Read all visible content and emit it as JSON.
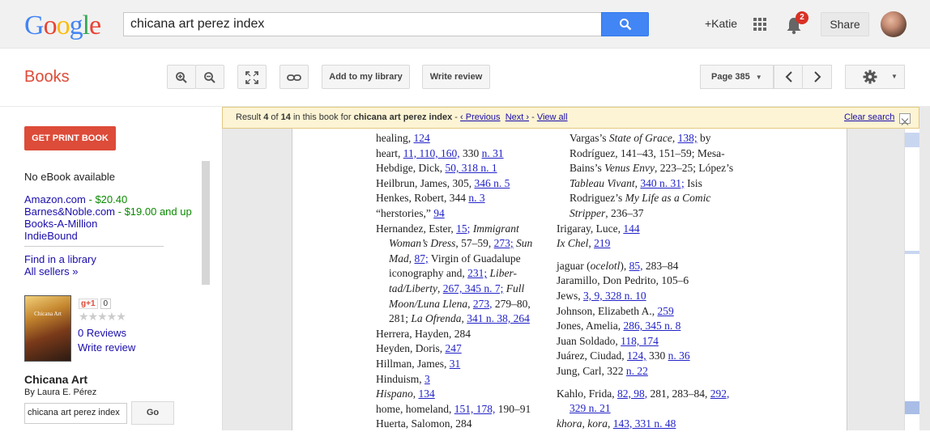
{
  "topbar": {
    "logo_letters": [
      {
        "c": "G",
        "color": "#4285f4"
      },
      {
        "c": "o",
        "color": "#ea4335"
      },
      {
        "c": "o",
        "color": "#fbbc05"
      },
      {
        "c": "g",
        "color": "#4285f4"
      },
      {
        "c": "l",
        "color": "#34a853"
      },
      {
        "c": "e",
        "color": "#ea4335"
      }
    ],
    "search_value": "chicana art perez index",
    "user": "+Katie",
    "notif_count": "2",
    "share": "Share"
  },
  "toolbar": {
    "app_name": "Books",
    "add_library": "Add to my library",
    "write_review": "Write review",
    "page_select": "Page 385"
  },
  "sidebar": {
    "print_button": "GET PRINT BOOK",
    "no_ebook": "No eBook available",
    "sellers": [
      {
        "name": "Amazon.com",
        "price": "- $20.40"
      },
      {
        "name": "Barnes&Noble.com",
        "price": "- $19.00 and up"
      },
      {
        "name": "Books-A-Million",
        "price": ""
      },
      {
        "name": "IndieBound",
        "price": ""
      }
    ],
    "find_library": "Find in a library",
    "all_sellers": "All sellers »",
    "cover_text": "Chicana Art",
    "gplus": "g+1",
    "gplus_count": "0",
    "stars": "★★★★★",
    "reviews_count": "0 Reviews",
    "write_review": "Write review",
    "title": "Chicana Art",
    "author": "By Laura E. Pérez",
    "search_value": "chicana art perez index",
    "go": "Go"
  },
  "result": {
    "p1": "Result ",
    "current": "4",
    "p2": " of ",
    "total": "14",
    "p3": " in this book for ",
    "query": "chicana art perez index",
    "sep1": " - ",
    "previous": "‹ Previous",
    "next": "Next ›",
    "sep2": " - ",
    "view_all": "View all",
    "clear": "Clear search"
  },
  "index_col1": [
    [
      {
        "t": "healing, "
      },
      {
        "t": "124",
        "l": 1
      }
    ],
    [
      {
        "t": "heart, "
      },
      {
        "t": "11, 110, 160,",
        "l": 1
      },
      {
        "t": " 330 "
      },
      {
        "t": "n. 31",
        "l": 1
      }
    ],
    [
      {
        "t": "Hebdige, Dick, "
      },
      {
        "t": "50, 318 n. 1",
        "l": 1
      }
    ],
    [
      {
        "t": "Heilbrun, James, 305, "
      },
      {
        "t": "346 n. 5",
        "l": 1
      }
    ],
    [
      {
        "t": "Henkes, Robert, 344 "
      },
      {
        "t": "n. 3",
        "l": 1
      }
    ],
    [
      {
        "t": "“herstories,” "
      },
      {
        "t": "94",
        "l": 1
      }
    ],
    [
      {
        "t": "Hernandez, Ester, "
      },
      {
        "t": "15;",
        "l": 1
      },
      {
        "t": " Immigrant",
        "i": 1
      }
    ],
    {
      "s": [
        {
          "t": "Woman’s Dress",
          "i": 1
        },
        {
          "t": ", 57–59, "
        },
        {
          "t": "273;",
          "l": 1
        },
        {
          "t": " Sun",
          "i": 1
        }
      ]
    },
    {
      "s": [
        {
          "t": "Mad",
          "i": 1
        },
        {
          "t": ", "
        },
        {
          "t": "87;",
          "l": 1
        },
        {
          "t": " Virgin of Guadalupe"
        }
      ]
    },
    {
      "s": [
        {
          "t": "iconography and, "
        },
        {
          "t": "231;",
          "l": 1
        },
        {
          "t": " Liber-",
          "i": 1
        }
      ]
    },
    {
      "s": [
        {
          "t": "tad/Liberty",
          "i": 1
        },
        {
          "t": ", "
        },
        {
          "t": "267, 345 n. 7;",
          "l": 1
        },
        {
          "t": " Full",
          "i": 1
        }
      ]
    },
    {
      "s": [
        {
          "t": "Moon/Luna Llena",
          "i": 1
        },
        {
          "t": ", "
        },
        {
          "t": "273,",
          "l": 1
        },
        {
          "t": " 279–80,"
        }
      ]
    },
    {
      "s": [
        {
          "t": "281; "
        },
        {
          "t": "La Ofrenda",
          "i": 1
        },
        {
          "t": ", "
        },
        {
          "t": "341 n. 38, 264",
          "l": 1
        }
      ]
    },
    [
      {
        "t": "Herrera, Hayden, 284"
      }
    ],
    [
      {
        "t": "Heyden, Doris, "
      },
      {
        "t": "247",
        "l": 1
      }
    ],
    [
      {
        "t": "Hillman, James, "
      },
      {
        "t": "31",
        "l": 1
      }
    ],
    [
      {
        "t": "Hinduism, "
      },
      {
        "t": "3",
        "l": 1
      }
    ],
    [
      {
        "t": "Hispano",
        "i": 1
      },
      {
        "t": ", "
      },
      {
        "t": "134",
        "l": 1
      }
    ],
    [
      {
        "t": "home, homeland, "
      },
      {
        "t": "151, 178,",
        "l": 1
      },
      {
        "t": " 190–91"
      }
    ],
    [
      {
        "t": "Huerta, Salomon, 284"
      }
    ]
  ],
  "index_col2": [
    {
      "s": [
        {
          "t": "Vargas’s "
        },
        {
          "t": "State of Grace",
          "i": 1
        },
        {
          "t": ", "
        },
        {
          "t": "138;",
          "l": 1
        },
        {
          "t": " by"
        }
      ]
    },
    {
      "s": [
        {
          "t": "Rodríguez, 141–43, 151–59; Mesa-"
        }
      ]
    },
    {
      "s": [
        {
          "t": "Bains’s "
        },
        {
          "t": "Venus Envy",
          "i": 1
        },
        {
          "t": ", 223–25; López’s"
        }
      ]
    },
    {
      "s": [
        {
          "t": "Tableau Vivant",
          "i": 1
        },
        {
          "t": ", "
        },
        {
          "t": "340 n. 31;",
          "l": 1
        },
        {
          "t": " Isis"
        }
      ]
    },
    {
      "s": [
        {
          "t": "Rodriguez’s "
        },
        {
          "t": "My Life as a Comic",
          "i": 1
        }
      ]
    },
    {
      "s": [
        {
          "t": "Stripper",
          "i": 1
        },
        {
          "t": ", 236–37"
        }
      ]
    },
    [
      {
        "t": "Irigaray, Luce, "
      },
      {
        "t": "144",
        "l": 1
      }
    ],
    [
      {
        "t": "Ix Chel",
        "i": 1
      },
      {
        "t": ", "
      },
      {
        "t": "219",
        "l": 1
      }
    ],
    "gap",
    [
      {
        "t": "jaguar ("
      },
      {
        "t": "ocelotl",
        "i": 1
      },
      {
        "t": "), "
      },
      {
        "t": "85,",
        "l": 1
      },
      {
        "t": " 283–84"
      }
    ],
    [
      {
        "t": "Jaramillo, Don Pedrito, 105–6"
      }
    ],
    [
      {
        "t": "Jews, "
      },
      {
        "t": "3, 9, 328 n. 10",
        "l": 1
      }
    ],
    [
      {
        "t": "Johnson, Elizabeth A., "
      },
      {
        "t": "259",
        "l": 1
      }
    ],
    [
      {
        "t": "Jones, Amelia, "
      },
      {
        "t": "286, 345 n. 8",
        "l": 1
      }
    ],
    [
      {
        "t": "Juan Soldado, "
      },
      {
        "t": "118, 174",
        "l": 1
      }
    ],
    [
      {
        "t": "Juárez, Ciudad, "
      },
      {
        "t": "124,",
        "l": 1
      },
      {
        "t": " 330 "
      },
      {
        "t": "n. 36",
        "l": 1
      }
    ],
    [
      {
        "t": "Jung, Carl, 322 "
      },
      {
        "t": "n. 22",
        "l": 1
      }
    ],
    "gap",
    [
      {
        "t": "Kahlo, Frida, "
      },
      {
        "t": "82, 98,",
        "l": 1
      },
      {
        "t": " 281, 283–84, "
      },
      {
        "t": "292,",
        "l": 1
      }
    ],
    {
      "s": [
        {
          "t": "329 n. 21",
          "l": 1
        }
      ]
    },
    [
      {
        "t": "khora, kora",
        "i": 1
      },
      {
        "t": ", "
      },
      {
        "t": "143, 331 n. 48",
        "l": 1
      }
    ]
  ]
}
